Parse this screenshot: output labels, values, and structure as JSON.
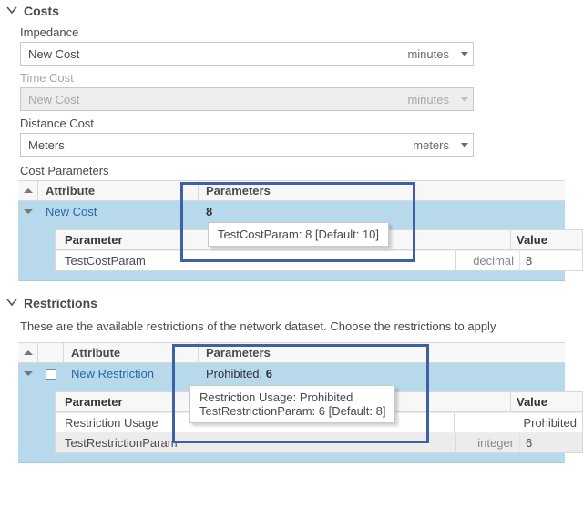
{
  "costs": {
    "section_title": "Costs",
    "impedance": {
      "label": "Impedance",
      "value": "New Cost",
      "unit": "minutes"
    },
    "time_cost": {
      "label": "Time Cost",
      "value": "New Cost",
      "unit": "minutes"
    },
    "distance_cost": {
      "label": "Distance Cost",
      "value": "Meters",
      "unit": "meters"
    },
    "cost_params_label": "Cost Parameters",
    "grid": {
      "headers": {
        "attribute": "Attribute",
        "parameters": "Parameters",
        "parameter": "Parameter",
        "value": "Value"
      },
      "row": {
        "attribute": "New Cost",
        "parameters_summary": "8"
      },
      "nested": {
        "rows": [
          {
            "name": "TestCostParam",
            "type": "decimal",
            "value": "8"
          }
        ]
      },
      "tooltip": "TestCostParam: 8 [Default: 10]"
    }
  },
  "restrictions": {
    "section_title": "Restrictions",
    "description": "These are the available restrictions of the network dataset. Choose the restrictions to apply",
    "grid": {
      "headers": {
        "attribute": "Attribute",
        "parameters": "Parameters",
        "parameter": "Parameter",
        "value": "Value"
      },
      "row": {
        "attribute": "New Restriction",
        "parameters_summary": "Prohibited, 6",
        "parameters_summary_pre": "Prohibited, ",
        "parameters_summary_bold": "6"
      },
      "nested": {
        "rows": [
          {
            "name": "Restriction Usage",
            "type": "",
            "value": "Prohibited"
          },
          {
            "name": "TestRestrictionParam",
            "type": "integer",
            "value": "6"
          }
        ]
      },
      "tooltip_line1": "Restriction Usage: Prohibited",
      "tooltip_line2": "TestRestrictionParam: 6 [Default: 8]"
    }
  }
}
